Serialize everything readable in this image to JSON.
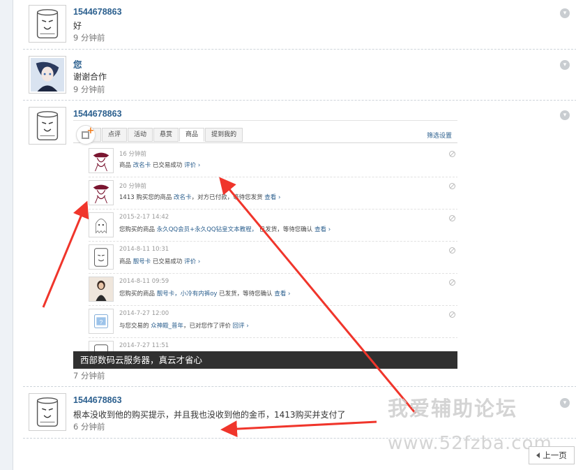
{
  "colors": {
    "link": "#2b5f8e",
    "arrow": "#f0352b",
    "accent_orange": "#f07a1a"
  },
  "comments": [
    {
      "user": "1544678863",
      "text": "好",
      "time": "9 分钟前",
      "avatar": "toilet-paper-face-avatar"
    },
    {
      "user": "您",
      "text": "谢谢合作",
      "time": "9 分钟前",
      "avatar": "anime-character-avatar"
    },
    {
      "user": "1544678863",
      "text": "",
      "time": "7 分钟前",
      "avatar": "toilet-paper-face-avatar"
    },
    {
      "user": "1544678863",
      "text": "根本没收到他的购买提示，并且我也没收到他的金币，1413购买并支付了",
      "time": "6 分钟前",
      "avatar": "toilet-paper-face-avatar"
    }
  ],
  "screenshot": {
    "tabs": [
      "",
      "点评",
      "活动",
      "悬赏",
      "商品",
      "提到我的"
    ],
    "active_tab": 4,
    "filter_label": "筛选设置",
    "notices": [
      {
        "time": "16 分钟前",
        "pre": "商品 ",
        "link": "改名卡",
        "mid": " 已交易成功  ",
        "action": "评价 ›"
      },
      {
        "time": "20 分钟前",
        "pre": "1413 购买您的商品 ",
        "link": "改名卡",
        "mid": "，对方已付款，等待您发货  ",
        "action": "查看 ›"
      },
      {
        "time": "2015-2-17 14:42",
        "pre": "您购买的商品 ",
        "link": "永久QQ会员+永久QQ钻皇文本教程，",
        "mid": "  已发货，等待您确认  ",
        "action": "查看 ›"
      },
      {
        "time": "2014-8-11 10:31",
        "pre": "商品 ",
        "link": "靓号卡",
        "mid": " 已交易成功  ",
        "action": "评价 ›"
      },
      {
        "time": "2014-8-11 09:59",
        "pre": "您购买的商品 ",
        "link": "靓号卡，小冷有内裤oy",
        "mid": " 已发货，等待您确认  ",
        "action": "查看 ›"
      },
      {
        "time": "2014-7-27 12:00",
        "pre": "与您交易的 ",
        "link": "众神殿_普年",
        "mid": "，已对您作了评价  ",
        "action": "回评 ›"
      },
      {
        "time": "2014-7-27 11:51",
        "pre": "",
        "link": "",
        "mid": "",
        "action": ""
      }
    ],
    "ad_text": "西部数码云服务器，真云才省心"
  },
  "watermark": {
    "title": "我爱辅助论坛",
    "url": "www.52fzba.com"
  },
  "pagination": {
    "prev_label": "上一页"
  }
}
